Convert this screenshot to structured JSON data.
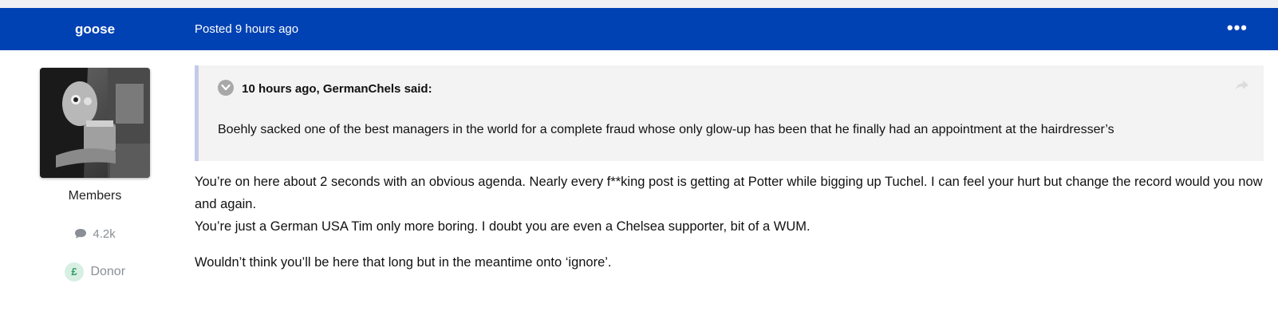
{
  "post": {
    "author": "goose",
    "posted_time": "Posted 9 hours ago",
    "menu_glyph": "•••"
  },
  "author_panel": {
    "group": "Members",
    "post_count": "4.2k",
    "badge_symbol": "£",
    "badge_label": "Donor"
  },
  "quote": {
    "citation": "10 hours ago, GermanChels said:",
    "text": "Boehly sacked one of the best managers in the world for a complete fraud whose only glow-up has been that he finally had an appointment at the hairdresser’s"
  },
  "body": {
    "paragraph1": "You’re on here about 2 seconds with an obvious agenda. Nearly every f**king post is getting at Potter while bigging  up Tuchel. I can feel your hurt but change the record would you now and again.",
    "paragraph2": "You’re just a German USA Tim only more boring. I doubt you are even a Chelsea supporter, bit of a WUM.",
    "paragraph3": "Wouldn’t think you’ll be here that long but in the meantime onto ‘ignore’."
  },
  "colors": {
    "header_bg": "#0041b3",
    "quote_bg": "#f3f3f3",
    "quote_border": "#c4cbe8",
    "donor_green": "#2e9c63"
  },
  "icons": {
    "menu": "ellipsis-icon",
    "comments": "speech-bubble-icon",
    "quote_toggle": "chevron-down-icon",
    "share": "share-arrow-icon"
  }
}
